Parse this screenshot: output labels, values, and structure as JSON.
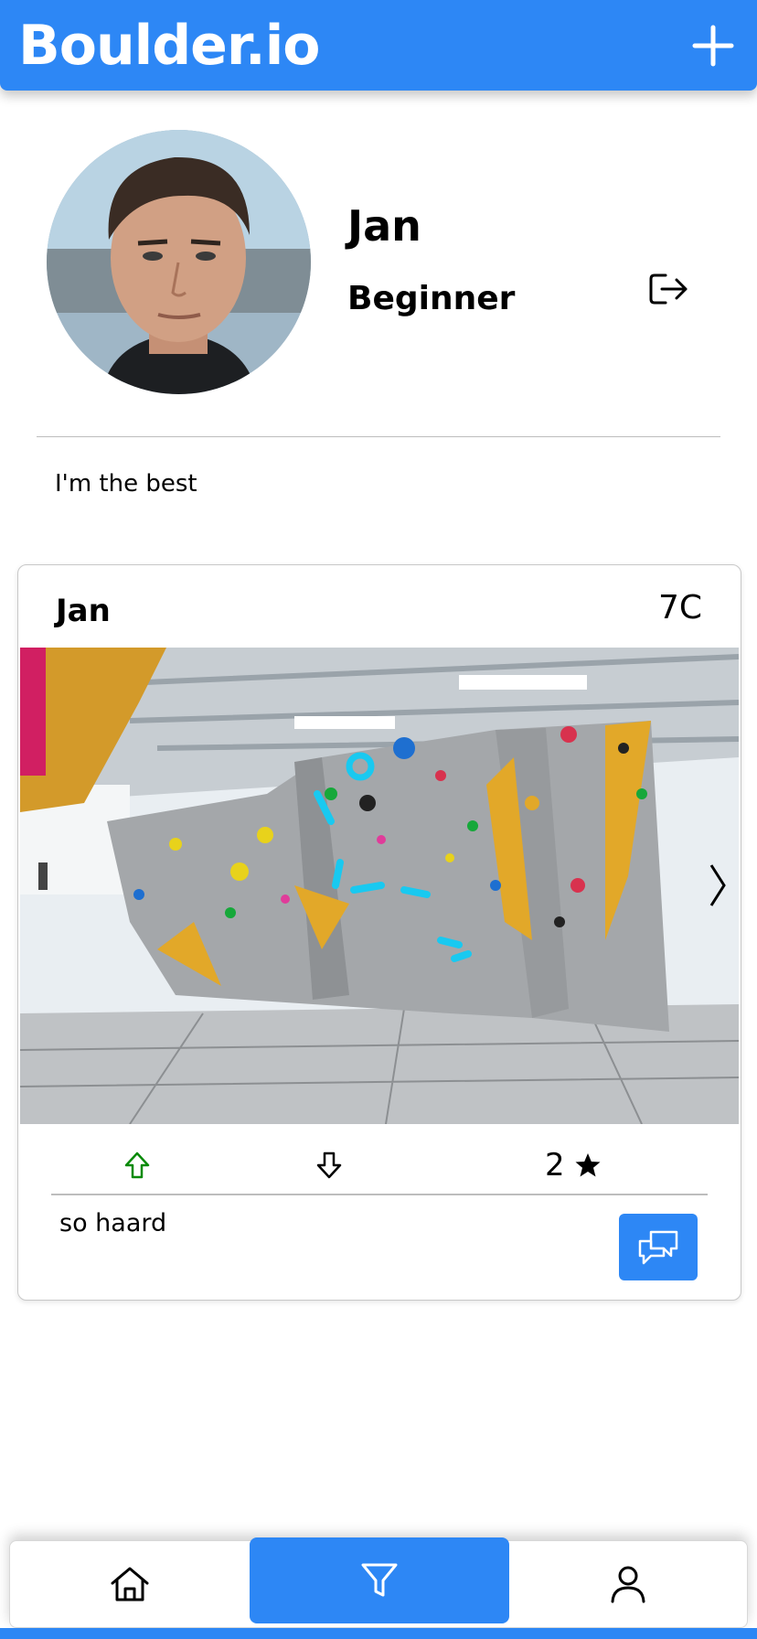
{
  "header": {
    "title": "Boulder.io",
    "add_icon": "plus-icon"
  },
  "profile": {
    "name": "Jan",
    "level": "Beginner",
    "bio": "I'm the best",
    "logout_icon": "logout-icon"
  },
  "post": {
    "author": "Jan",
    "grade": "7C",
    "rating": "2",
    "comment": "so haard",
    "upvote_icon": "arrow-up-icon",
    "downvote_icon": "arrow-down-icon",
    "comments_icon": "chat-bubbles-icon"
  },
  "bottom_nav": {
    "items": [
      {
        "icon": "home-icon",
        "active": false
      },
      {
        "icon": "filter-icon",
        "active": true
      },
      {
        "icon": "user-icon",
        "active": false
      }
    ]
  },
  "colors": {
    "accent": "#2d87f5",
    "upvote": "#0a8a0a"
  }
}
